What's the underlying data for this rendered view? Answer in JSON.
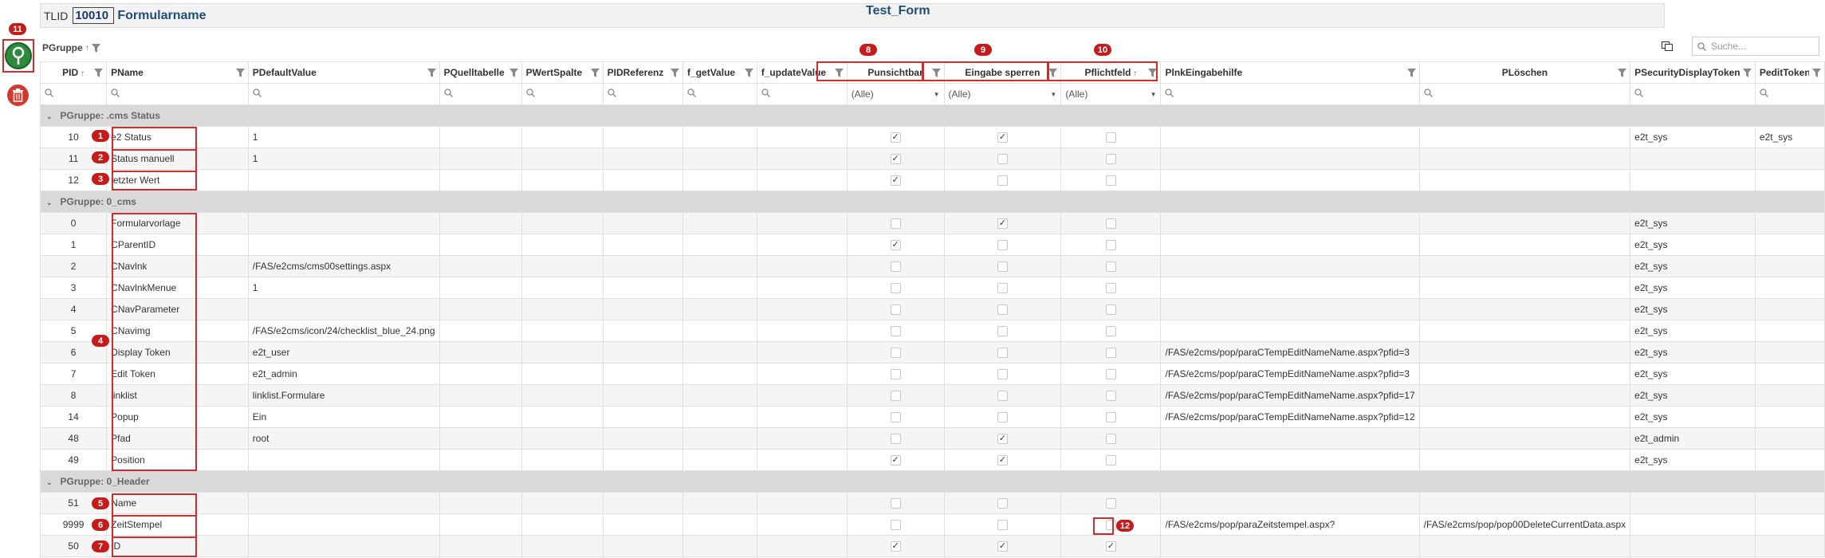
{
  "header": {
    "tlid_label": "TLID",
    "tlid_value": "10010",
    "form_label": "Formularname",
    "form_name": "Test_Form"
  },
  "group_panel": {
    "label": "PGruppe"
  },
  "search": {
    "placeholder": "Suche..."
  },
  "columns": [
    {
      "key": "pid",
      "label": "PID"
    },
    {
      "key": "pname",
      "label": "PName"
    },
    {
      "key": "pdefault",
      "label": "PDefaultValue"
    },
    {
      "key": "pquell",
      "label": "PQuelltabelle"
    },
    {
      "key": "pwert",
      "label": "PWertSpalte"
    },
    {
      "key": "pidref",
      "label": "PIDReferenz"
    },
    {
      "key": "fget",
      "label": "f_getValue"
    },
    {
      "key": "fupd",
      "label": "f_updateValue"
    },
    {
      "key": "punsicht",
      "label": "Punsichtbar"
    },
    {
      "key": "eingabe",
      "label": "Eingabe sperren"
    },
    {
      "key": "pflicht",
      "label": "Pflichtfeld"
    },
    {
      "key": "plnk",
      "label": "PlnkEingabehilfe"
    },
    {
      "key": "ploeschen",
      "label": "PLöschen"
    },
    {
      "key": "psec",
      "label": "PSecurityDisplayToken"
    },
    {
      "key": "pedit",
      "label": "PeditToken"
    }
  ],
  "filter_select": "(Alle)",
  "groups": [
    {
      "label": "PGruppe: .cms Status",
      "rows": [
        {
          "pid": "10",
          "pname": "e2 Status",
          "pdefault": "1",
          "punsicht": true,
          "eingabe": true,
          "pflicht": false,
          "plnk": "",
          "ploeschen": "",
          "psec": "e2t_sys",
          "pedit": "e2t_sys"
        },
        {
          "pid": "11",
          "pname": "Status manuell",
          "pdefault": "1",
          "punsicht": true,
          "eingabe": false,
          "pflicht": false,
          "plnk": "",
          "ploeschen": "",
          "psec": "",
          "pedit": ""
        },
        {
          "pid": "12",
          "pname": "letzter Wert",
          "pdefault": "",
          "punsicht": true,
          "eingabe": false,
          "pflicht": false,
          "plnk": "",
          "ploeschen": "",
          "psec": "",
          "pedit": ""
        }
      ]
    },
    {
      "label": "PGruppe: 0_cms",
      "rows": [
        {
          "pid": "0",
          "pname": "Formularvorlage",
          "pdefault": "",
          "punsicht": false,
          "eingabe": true,
          "pflicht": false,
          "plnk": "",
          "ploeschen": "",
          "psec": "e2t_sys",
          "pedit": ""
        },
        {
          "pid": "1",
          "pname": "CParentID",
          "pdefault": "",
          "punsicht": true,
          "eingabe": false,
          "pflicht": false,
          "plnk": "",
          "ploeschen": "",
          "psec": "e2t_sys",
          "pedit": ""
        },
        {
          "pid": "2",
          "pname": "CNavlnk",
          "pdefault": "/FAS/e2cms/cms00settings.aspx",
          "punsicht": false,
          "eingabe": false,
          "pflicht": false,
          "plnk": "",
          "ploeschen": "",
          "psec": "e2t_sys",
          "pedit": ""
        },
        {
          "pid": "3",
          "pname": "CNavlnkMenue",
          "pdefault": "1",
          "punsicht": false,
          "eingabe": false,
          "pflicht": false,
          "plnk": "",
          "ploeschen": "",
          "psec": "e2t_sys",
          "pedit": ""
        },
        {
          "pid": "4",
          "pname": "CNavParameter",
          "pdefault": "",
          "punsicht": false,
          "eingabe": false,
          "pflicht": false,
          "plnk": "",
          "ploeschen": "",
          "psec": "e2t_sys",
          "pedit": ""
        },
        {
          "pid": "5",
          "pname": "CNavimg",
          "pdefault": "/FAS/e2cms/icon/24/checklist_blue_24.png",
          "punsicht": false,
          "eingabe": false,
          "pflicht": false,
          "plnk": "",
          "ploeschen": "",
          "psec": "e2t_sys",
          "pedit": ""
        },
        {
          "pid": "6",
          "pname": "Display Token",
          "pdefault": "e2t_user",
          "punsicht": false,
          "eingabe": false,
          "pflicht": false,
          "plnk": "/FAS/e2cms/pop/paraCTempEditNameName.aspx?pfid=3",
          "ploeschen": "",
          "psec": "e2t_sys",
          "pedit": ""
        },
        {
          "pid": "7",
          "pname": "Edit Token",
          "pdefault": "e2t_admin",
          "punsicht": false,
          "eingabe": false,
          "pflicht": false,
          "plnk": "/FAS/e2cms/pop/paraCTempEditNameName.aspx?pfid=3",
          "ploeschen": "",
          "psec": "e2t_sys",
          "pedit": ""
        },
        {
          "pid": "8",
          "pname": "linklist",
          "pdefault": "linklist.Formulare",
          "punsicht": false,
          "eingabe": false,
          "pflicht": false,
          "plnk": "/FAS/e2cms/pop/paraCTempEditNameName.aspx?pfid=17",
          "ploeschen": "",
          "psec": "e2t_sys",
          "pedit": ""
        },
        {
          "pid": "14",
          "pname": "Popup",
          "pdefault": "Ein",
          "punsicht": false,
          "eingabe": false,
          "pflicht": false,
          "plnk": "/FAS/e2cms/pop/paraCTempEditNameName.aspx?pfid=12",
          "ploeschen": "",
          "psec": "e2t_sys",
          "pedit": ""
        },
        {
          "pid": "48",
          "pname": "Pfad",
          "pdefault": "root",
          "punsicht": false,
          "eingabe": true,
          "pflicht": false,
          "plnk": "",
          "ploeschen": "",
          "psec": "e2t_admin",
          "pedit": ""
        },
        {
          "pid": "49",
          "pname": "Position",
          "pdefault": "",
          "punsicht": true,
          "eingabe": true,
          "pflicht": false,
          "plnk": "",
          "ploeschen": "",
          "psec": "e2t_sys",
          "pedit": ""
        }
      ]
    },
    {
      "label": "PGruppe: 0_Header",
      "rows": [
        {
          "pid": "51",
          "pname": "Name",
          "pdefault": "",
          "punsicht": false,
          "eingabe": false,
          "pflicht": false,
          "plnk": "",
          "ploeschen": "",
          "psec": "",
          "pedit": ""
        },
        {
          "pid": "9999",
          "pname": "ZeitStempel",
          "pdefault": "",
          "punsicht": false,
          "eingabe": false,
          "pflicht": false,
          "plnk": "/FAS/e2cms/pop/paraZeitstempel.aspx?",
          "ploeschen": "/FAS/e2cms/pop/pop00DeleteCurrentData.aspx",
          "psec": "",
          "pedit": ""
        },
        {
          "pid": "50",
          "pname": "ID",
          "pdefault": "",
          "punsicht": true,
          "eingabe": true,
          "pflicht": true,
          "plnk": "",
          "ploeschen": "",
          "psec": "",
          "pedit": ""
        }
      ]
    }
  ],
  "annotations": [
    "1",
    "2",
    "3",
    "4",
    "5",
    "6",
    "7",
    "8",
    "9",
    "10",
    "11",
    "12"
  ]
}
